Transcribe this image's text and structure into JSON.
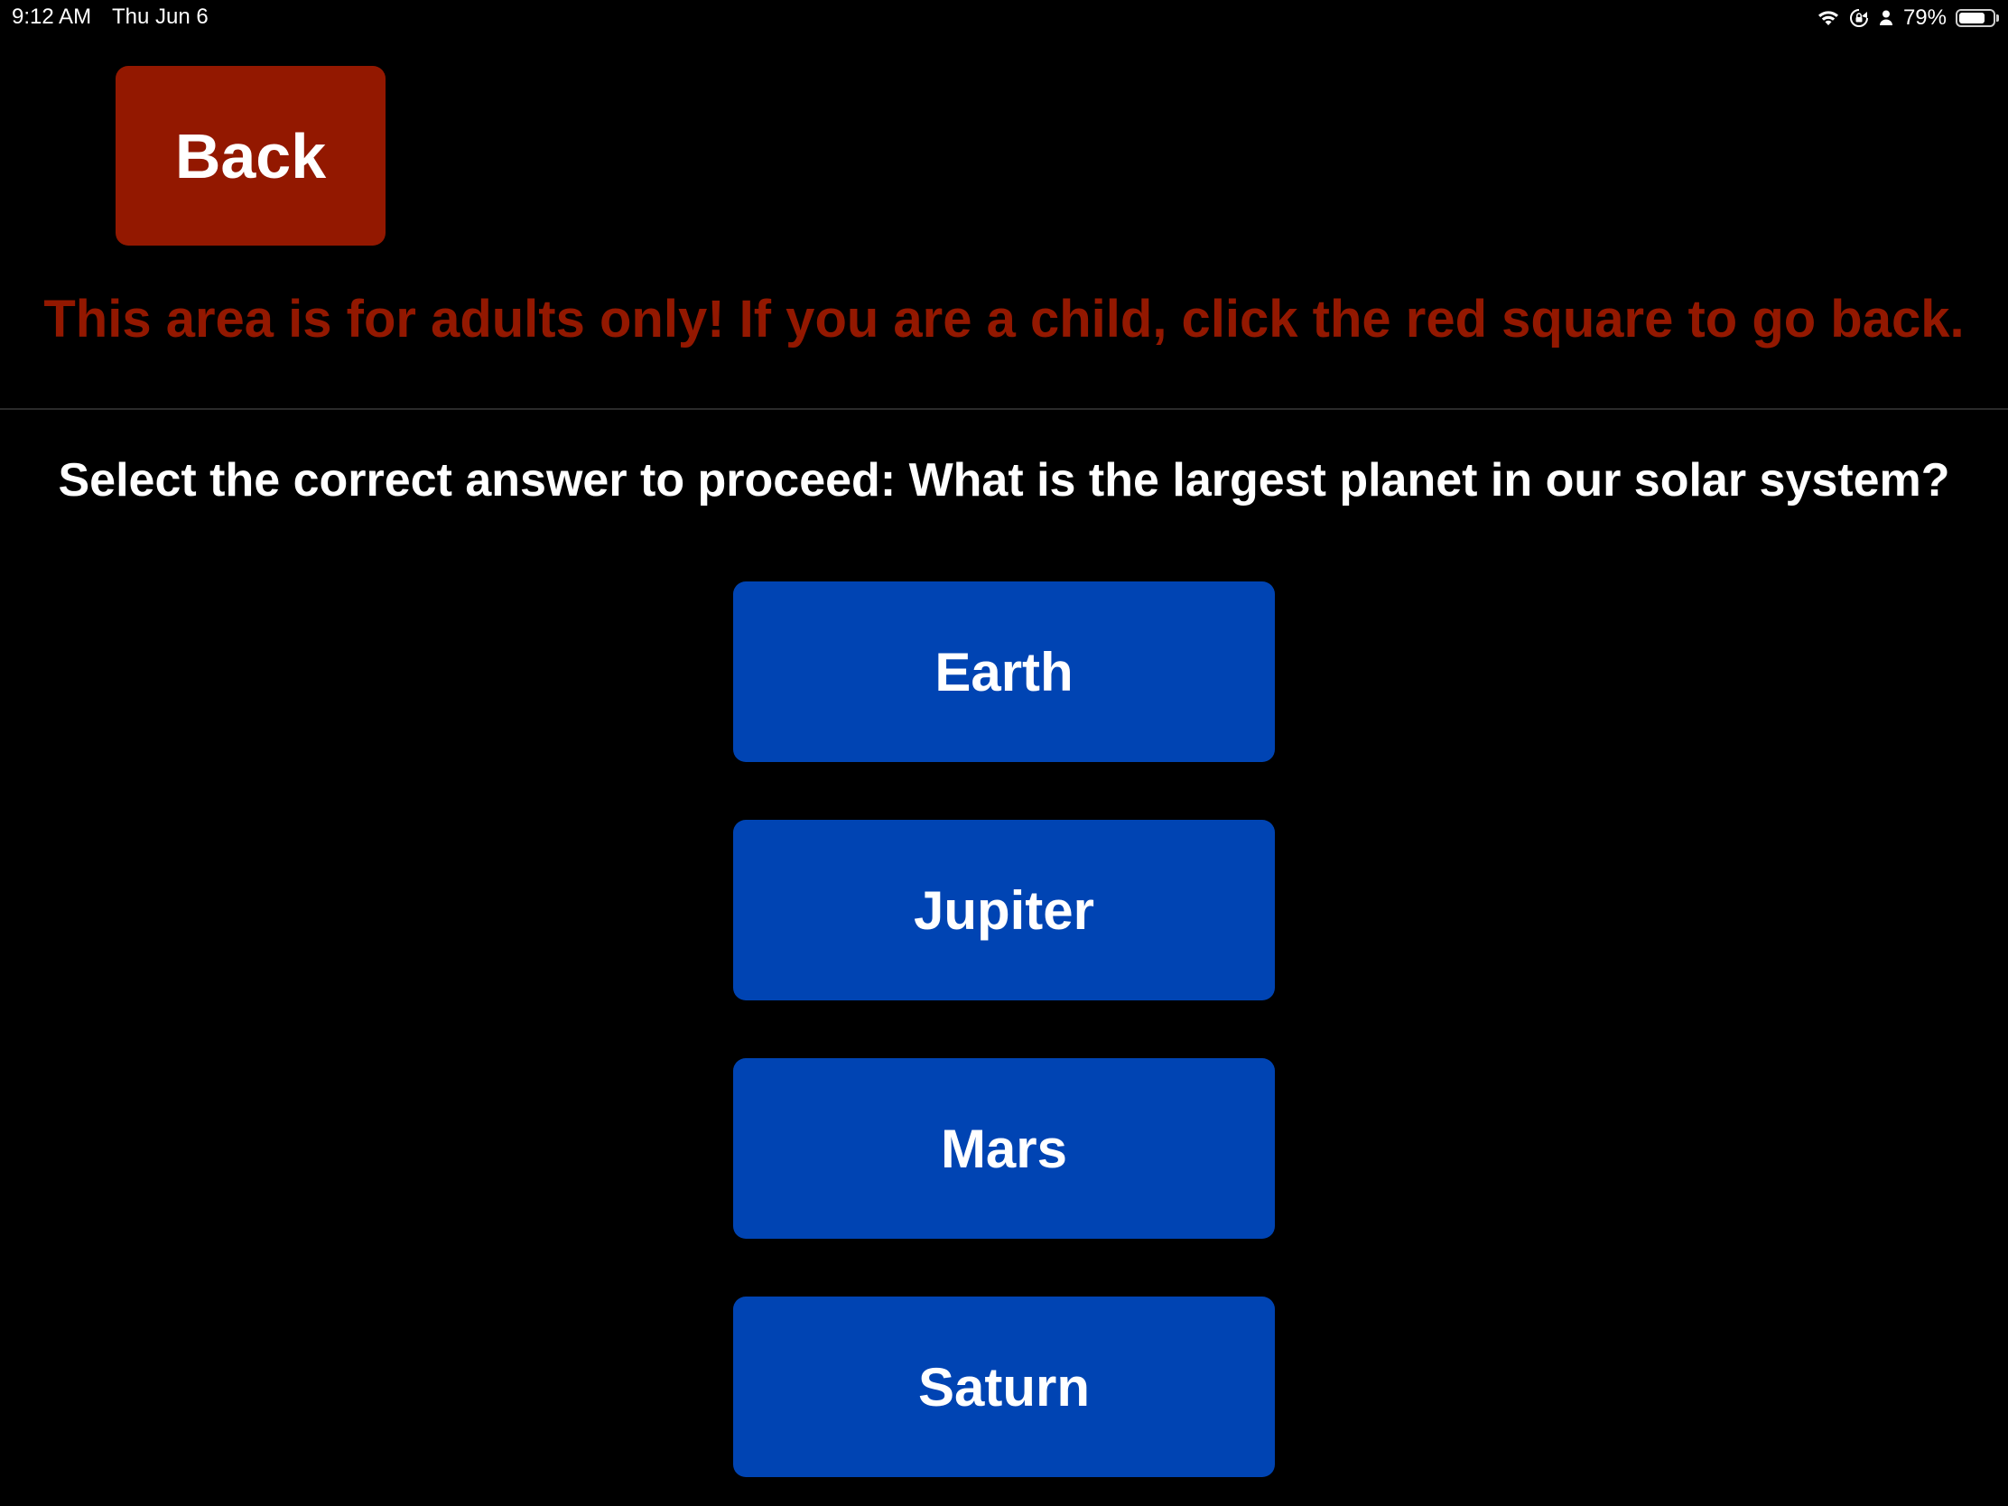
{
  "status_bar": {
    "time": "9:12 AM",
    "date": "Thu Jun 6",
    "battery_percent_label": "79%",
    "battery_level": 0.79,
    "icons": [
      "wifi-icon",
      "screen-lock-rotation-icon",
      "person-icon",
      "battery-icon"
    ]
  },
  "back_button": {
    "label": "Back",
    "color": "#931800"
  },
  "warning_text": "This area is for adults only! If you are a child, click the red square to go back.",
  "question_text": "Select the correct answer to proceed: What is the largest planet in our solar system?",
  "answers": [
    {
      "label": "Earth"
    },
    {
      "label": "Jupiter"
    },
    {
      "label": "Mars"
    },
    {
      "label": "Saturn"
    }
  ],
  "colors": {
    "background": "#000000",
    "warning": "#931800",
    "answer_button": "#0044b3",
    "text": "#ffffff"
  }
}
